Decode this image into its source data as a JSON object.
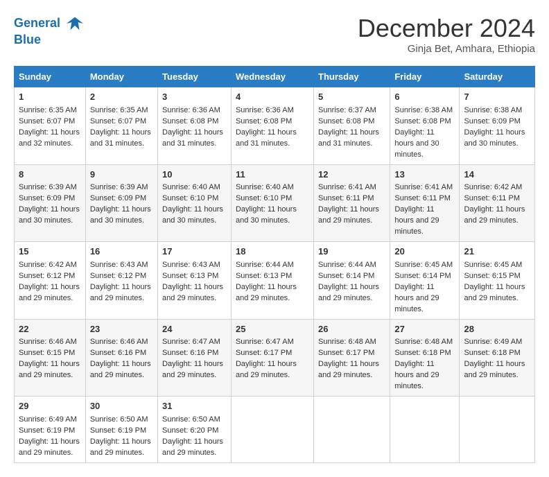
{
  "header": {
    "logo_line1": "General",
    "logo_line2": "Blue",
    "month": "December 2024",
    "location": "Ginja Bet, Amhara, Ethiopia"
  },
  "days_of_week": [
    "Sunday",
    "Monday",
    "Tuesday",
    "Wednesday",
    "Thursday",
    "Friday",
    "Saturday"
  ],
  "weeks": [
    [
      {
        "day": "1",
        "info": "Sunrise: 6:35 AM\nSunset: 6:07 PM\nDaylight: 11 hours and 32 minutes."
      },
      {
        "day": "2",
        "info": "Sunrise: 6:35 AM\nSunset: 6:07 PM\nDaylight: 11 hours and 31 minutes."
      },
      {
        "day": "3",
        "info": "Sunrise: 6:36 AM\nSunset: 6:08 PM\nDaylight: 11 hours and 31 minutes."
      },
      {
        "day": "4",
        "info": "Sunrise: 6:36 AM\nSunset: 6:08 PM\nDaylight: 11 hours and 31 minutes."
      },
      {
        "day": "5",
        "info": "Sunrise: 6:37 AM\nSunset: 6:08 PM\nDaylight: 11 hours and 31 minutes."
      },
      {
        "day": "6",
        "info": "Sunrise: 6:38 AM\nSunset: 6:08 PM\nDaylight: 11 hours and 30 minutes."
      },
      {
        "day": "7",
        "info": "Sunrise: 6:38 AM\nSunset: 6:09 PM\nDaylight: 11 hours and 30 minutes."
      }
    ],
    [
      {
        "day": "8",
        "info": "Sunrise: 6:39 AM\nSunset: 6:09 PM\nDaylight: 11 hours and 30 minutes."
      },
      {
        "day": "9",
        "info": "Sunrise: 6:39 AM\nSunset: 6:09 PM\nDaylight: 11 hours and 30 minutes."
      },
      {
        "day": "10",
        "info": "Sunrise: 6:40 AM\nSunset: 6:10 PM\nDaylight: 11 hours and 30 minutes."
      },
      {
        "day": "11",
        "info": "Sunrise: 6:40 AM\nSunset: 6:10 PM\nDaylight: 11 hours and 30 minutes."
      },
      {
        "day": "12",
        "info": "Sunrise: 6:41 AM\nSunset: 6:11 PM\nDaylight: 11 hours and 29 minutes."
      },
      {
        "day": "13",
        "info": "Sunrise: 6:41 AM\nSunset: 6:11 PM\nDaylight: 11 hours and 29 minutes."
      },
      {
        "day": "14",
        "info": "Sunrise: 6:42 AM\nSunset: 6:11 PM\nDaylight: 11 hours and 29 minutes."
      }
    ],
    [
      {
        "day": "15",
        "info": "Sunrise: 6:42 AM\nSunset: 6:12 PM\nDaylight: 11 hours and 29 minutes."
      },
      {
        "day": "16",
        "info": "Sunrise: 6:43 AM\nSunset: 6:12 PM\nDaylight: 11 hours and 29 minutes."
      },
      {
        "day": "17",
        "info": "Sunrise: 6:43 AM\nSunset: 6:13 PM\nDaylight: 11 hours and 29 minutes."
      },
      {
        "day": "18",
        "info": "Sunrise: 6:44 AM\nSunset: 6:13 PM\nDaylight: 11 hours and 29 minutes."
      },
      {
        "day": "19",
        "info": "Sunrise: 6:44 AM\nSunset: 6:14 PM\nDaylight: 11 hours and 29 minutes."
      },
      {
        "day": "20",
        "info": "Sunrise: 6:45 AM\nSunset: 6:14 PM\nDaylight: 11 hours and 29 minutes."
      },
      {
        "day": "21",
        "info": "Sunrise: 6:45 AM\nSunset: 6:15 PM\nDaylight: 11 hours and 29 minutes."
      }
    ],
    [
      {
        "day": "22",
        "info": "Sunrise: 6:46 AM\nSunset: 6:15 PM\nDaylight: 11 hours and 29 minutes."
      },
      {
        "day": "23",
        "info": "Sunrise: 6:46 AM\nSunset: 6:16 PM\nDaylight: 11 hours and 29 minutes."
      },
      {
        "day": "24",
        "info": "Sunrise: 6:47 AM\nSunset: 6:16 PM\nDaylight: 11 hours and 29 minutes."
      },
      {
        "day": "25",
        "info": "Sunrise: 6:47 AM\nSunset: 6:17 PM\nDaylight: 11 hours and 29 minutes."
      },
      {
        "day": "26",
        "info": "Sunrise: 6:48 AM\nSunset: 6:17 PM\nDaylight: 11 hours and 29 minutes."
      },
      {
        "day": "27",
        "info": "Sunrise: 6:48 AM\nSunset: 6:18 PM\nDaylight: 11 hours and 29 minutes."
      },
      {
        "day": "28",
        "info": "Sunrise: 6:49 AM\nSunset: 6:18 PM\nDaylight: 11 hours and 29 minutes."
      }
    ],
    [
      {
        "day": "29",
        "info": "Sunrise: 6:49 AM\nSunset: 6:19 PM\nDaylight: 11 hours and 29 minutes."
      },
      {
        "day": "30",
        "info": "Sunrise: 6:50 AM\nSunset: 6:19 PM\nDaylight: 11 hours and 29 minutes."
      },
      {
        "day": "31",
        "info": "Sunrise: 6:50 AM\nSunset: 6:20 PM\nDaylight: 11 hours and 29 minutes."
      },
      {
        "day": "",
        "info": ""
      },
      {
        "day": "",
        "info": ""
      },
      {
        "day": "",
        "info": ""
      },
      {
        "day": "",
        "info": ""
      }
    ]
  ]
}
